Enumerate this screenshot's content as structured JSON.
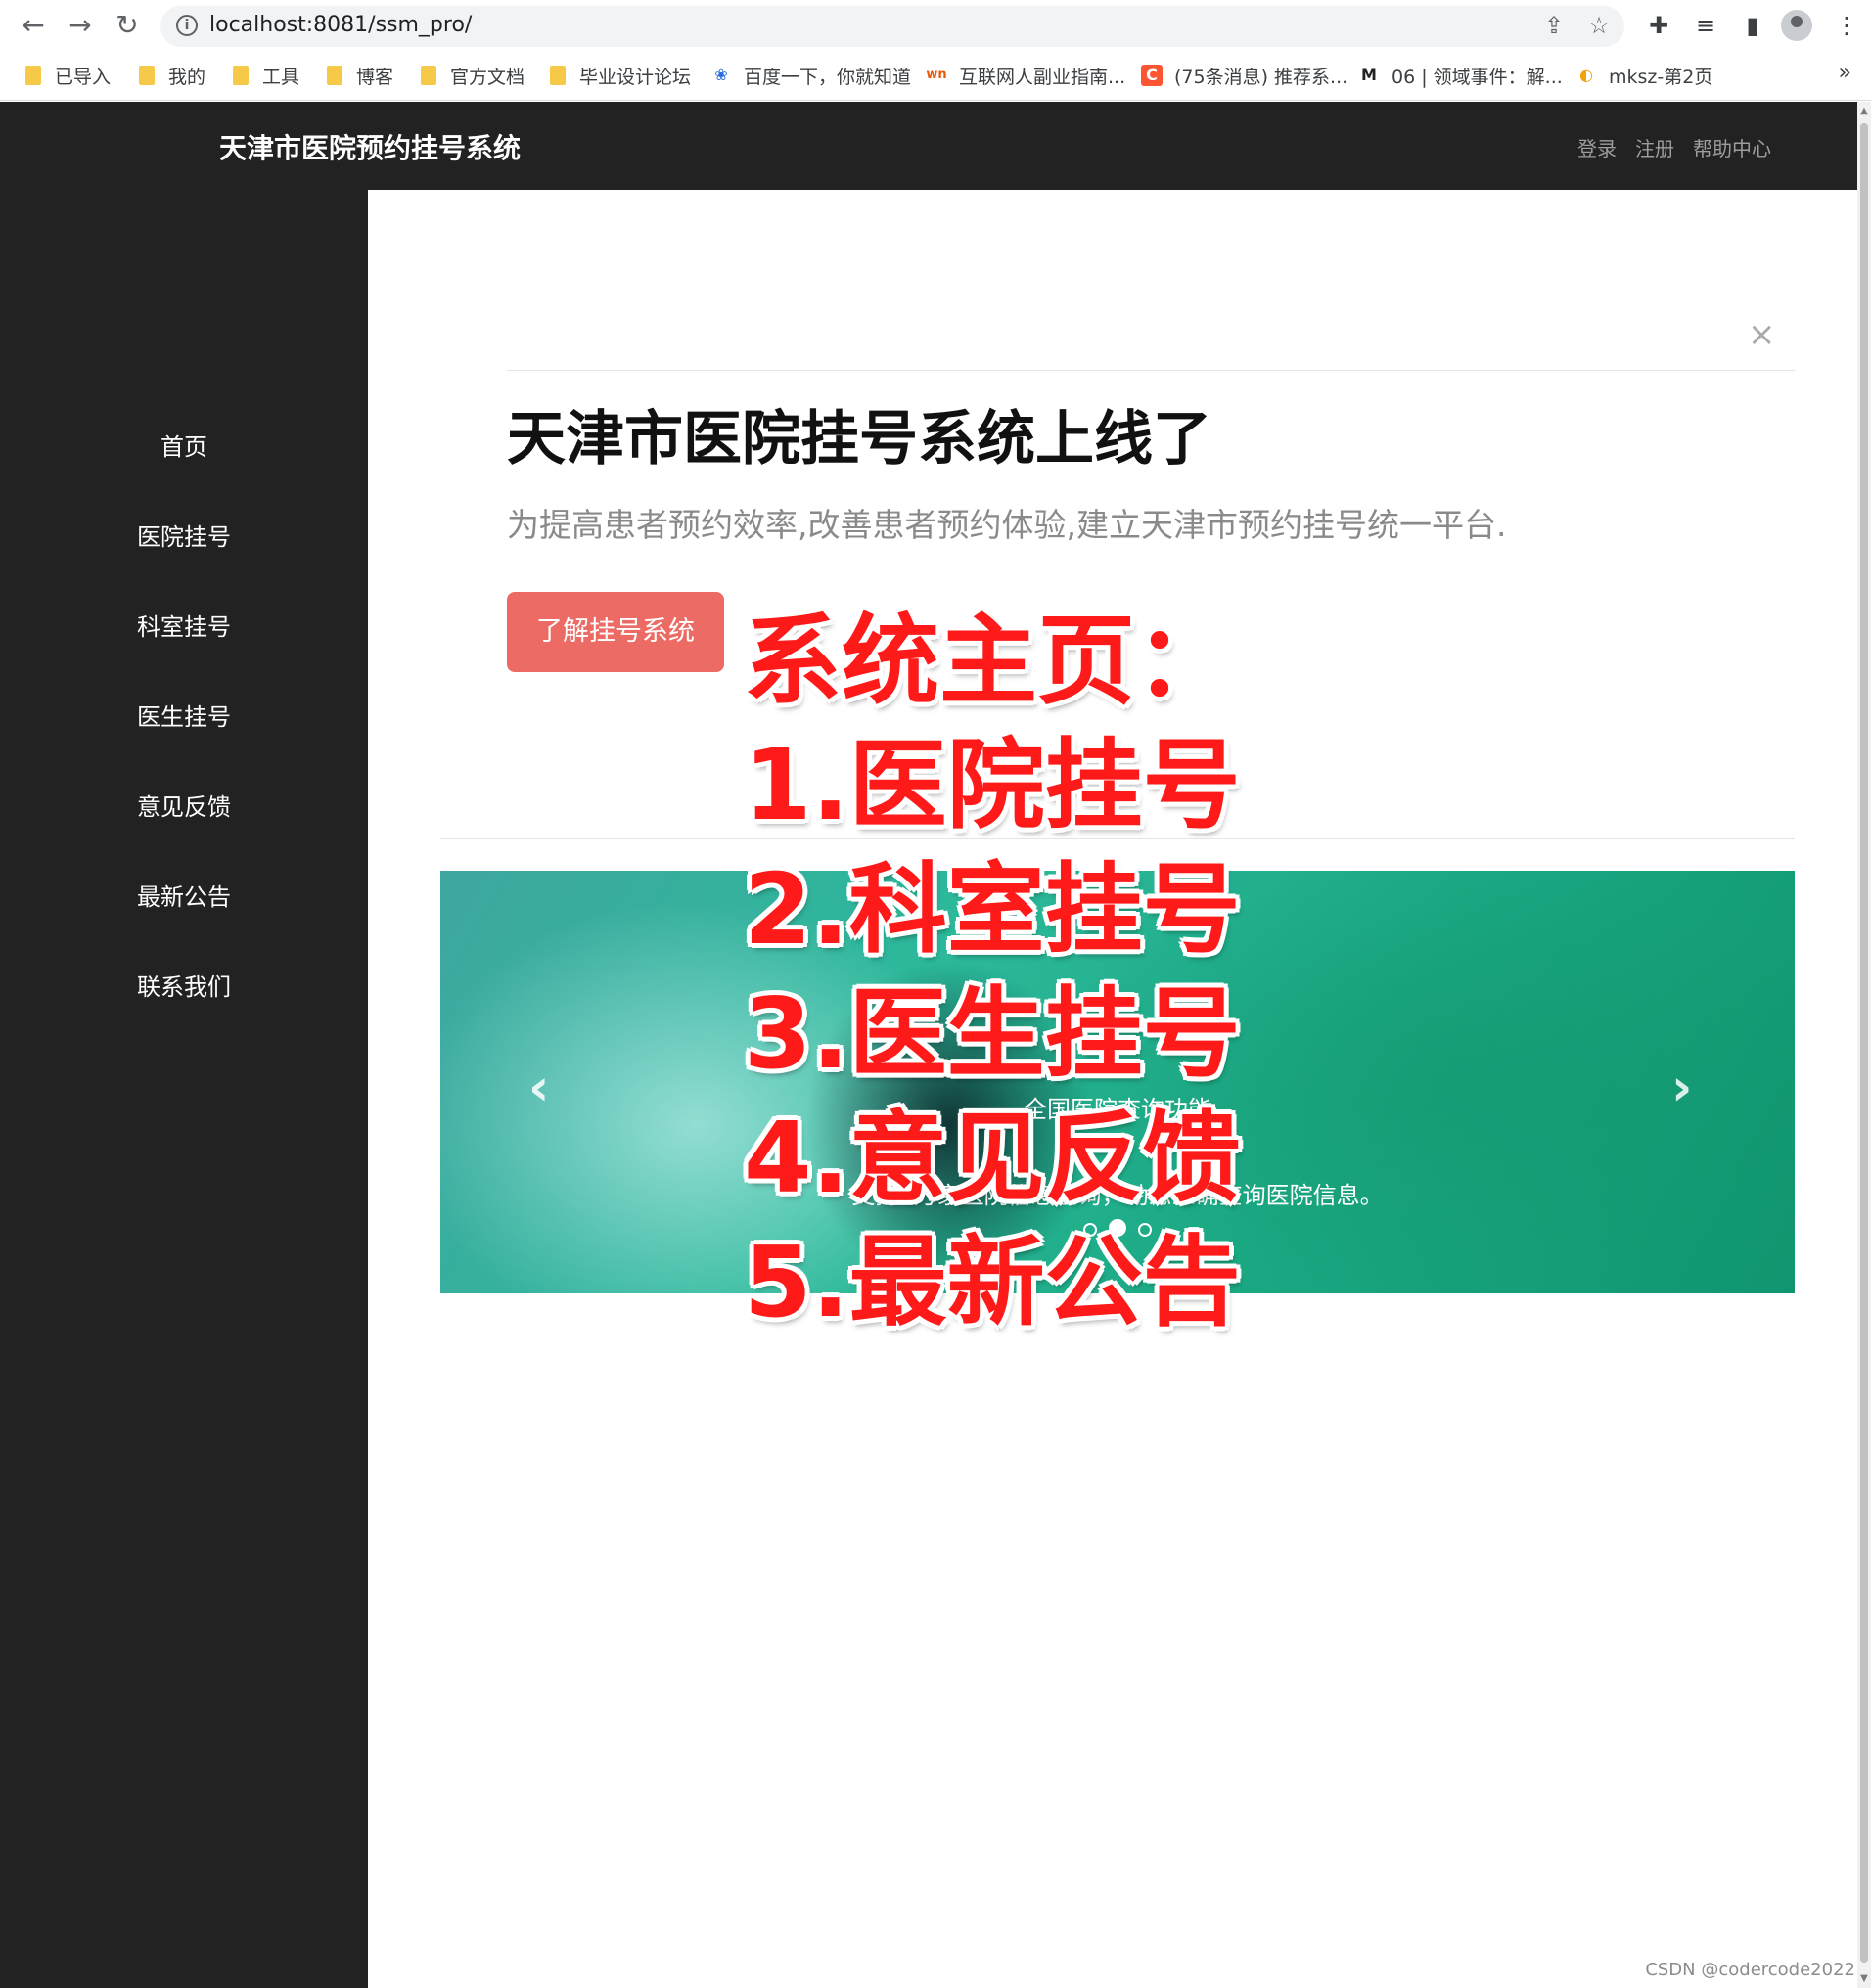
{
  "browser": {
    "url": "localhost:8081/ssm_pro/",
    "bookmarks": [
      {
        "label": "已导入",
        "icon": "folder-icon"
      },
      {
        "label": "我的",
        "icon": "folder-icon"
      },
      {
        "label": "工具",
        "icon": "folder-icon"
      },
      {
        "label": "博客",
        "icon": "folder-icon"
      },
      {
        "label": "官方文档",
        "icon": "folder-icon"
      },
      {
        "label": "毕业设计论坛",
        "icon": "folder-icon"
      },
      {
        "label": "百度一下，你就知道",
        "icon": "baidu-icon"
      },
      {
        "label": "互联网人副业指南...",
        "icon": "wn-icon"
      },
      {
        "label": "(75条消息) 推荐系...",
        "icon": "csdn-icon"
      },
      {
        "label": "06 | 领域事件：解...",
        "icon": "markdown-icon"
      },
      {
        "label": "mksz-第2页",
        "icon": "mksz-icon"
      }
    ],
    "more_label": "»"
  },
  "header": {
    "brand": "天津市医院预约挂号系统",
    "links": [
      "登录",
      "注册",
      "帮助中心"
    ]
  },
  "sidebar": {
    "items": [
      "首页",
      "医院挂号",
      "科室挂号",
      "医生挂号",
      "意见反馈",
      "最新公告",
      "联系我们"
    ]
  },
  "modal": {
    "close": "×",
    "title": "天津市医院挂号系统上线了",
    "lead": "为提高患者预约效率,改善患者预约体验,建立天津市预约挂号统一平台.",
    "button": "了解挂号系统"
  },
  "carousel": {
    "caption_title": "全国医院查询功能",
    "caption_text": "支持4万家医院信息查询，动态准确查询医院信息。",
    "slide_count": 3,
    "active_slide": 2
  },
  "overlay": {
    "lines": [
      "系统主页：",
      "1.医院挂号",
      "2.科室挂号",
      "3.医生挂号",
      "4.意见反馈",
      "5.最新公告"
    ]
  },
  "watermark": "CSDN @codercode2022",
  "colors": {
    "navbar": "#222222",
    "button": "#ed6b65",
    "overlay_text": "#ff1a1a"
  }
}
